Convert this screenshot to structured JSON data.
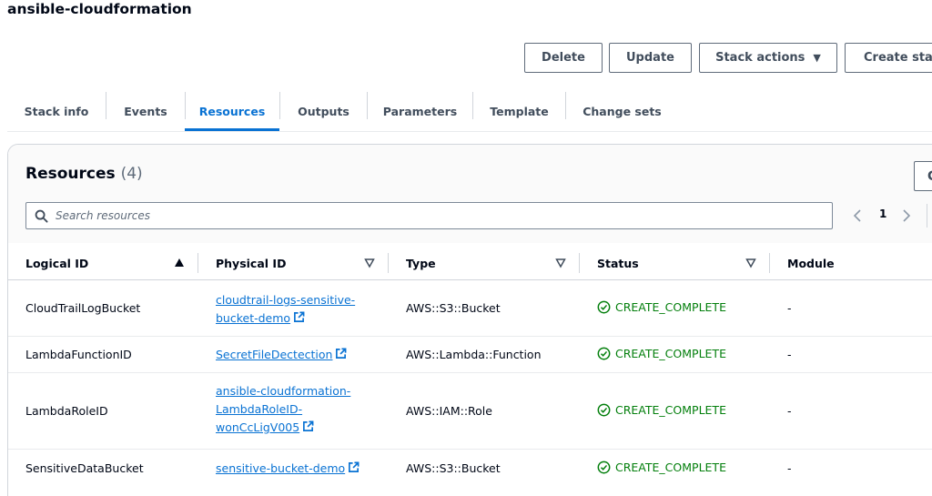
{
  "stack": {
    "title": "ansible-cloudformation"
  },
  "actions": {
    "delete": "Delete",
    "update": "Update",
    "stack_actions": "Stack actions",
    "create": "Create stac"
  },
  "tabs": [
    {
      "label": "Stack info"
    },
    {
      "label": "Events"
    },
    {
      "label": "Resources",
      "active": true
    },
    {
      "label": "Outputs"
    },
    {
      "label": "Parameters"
    },
    {
      "label": "Template"
    },
    {
      "label": "Change sets"
    }
  ],
  "resources": {
    "title": "Resources",
    "count": "(4)",
    "refresh_label": "C",
    "search_placeholder": "Search resources",
    "page": "1",
    "columns": {
      "logical_id": "Logical ID",
      "physical_id": "Physical ID",
      "type": "Type",
      "status": "Status",
      "module": "Module"
    },
    "rows": [
      {
        "logical_id": "CloudTrailLogBucket",
        "physical_id_lines": [
          "cloudtrail-logs-sensitive-",
          "bucket-demo"
        ],
        "type": "AWS::S3::Bucket",
        "status": "CREATE_COMPLETE",
        "module": "-"
      },
      {
        "logical_id": "LambdaFunctionID",
        "physical_id_lines": [
          "SecretFileDectection"
        ],
        "type": "AWS::Lambda::Function",
        "status": "CREATE_COMPLETE",
        "module": "-"
      },
      {
        "logical_id": "LambdaRoleID",
        "physical_id_lines": [
          "ansible-cloudformation-",
          "LambdaRoleID-",
          "wonCcLigV005"
        ],
        "type": "AWS::IAM::Role",
        "status": "CREATE_COMPLETE",
        "module": "-"
      },
      {
        "logical_id": "SensitiveDataBucket",
        "physical_id_lines": [
          "sensitive-bucket-demo"
        ],
        "type": "AWS::S3::Bucket",
        "status": "CREATE_COMPLETE",
        "module": "-"
      }
    ]
  },
  "colors": {
    "accent": "#0972d3",
    "success": "#037f0c",
    "text": "#000716",
    "muted": "#5f6b7a"
  },
  "icons": {
    "search": "search-icon",
    "external": "external-link-icon",
    "status_ok": "check-circle-icon",
    "sort_asc": "sort-ascending-icon",
    "sort": "sort-icon",
    "caret": "caret-down-icon",
    "prev": "chevron-left-icon",
    "next": "chevron-right-icon"
  }
}
